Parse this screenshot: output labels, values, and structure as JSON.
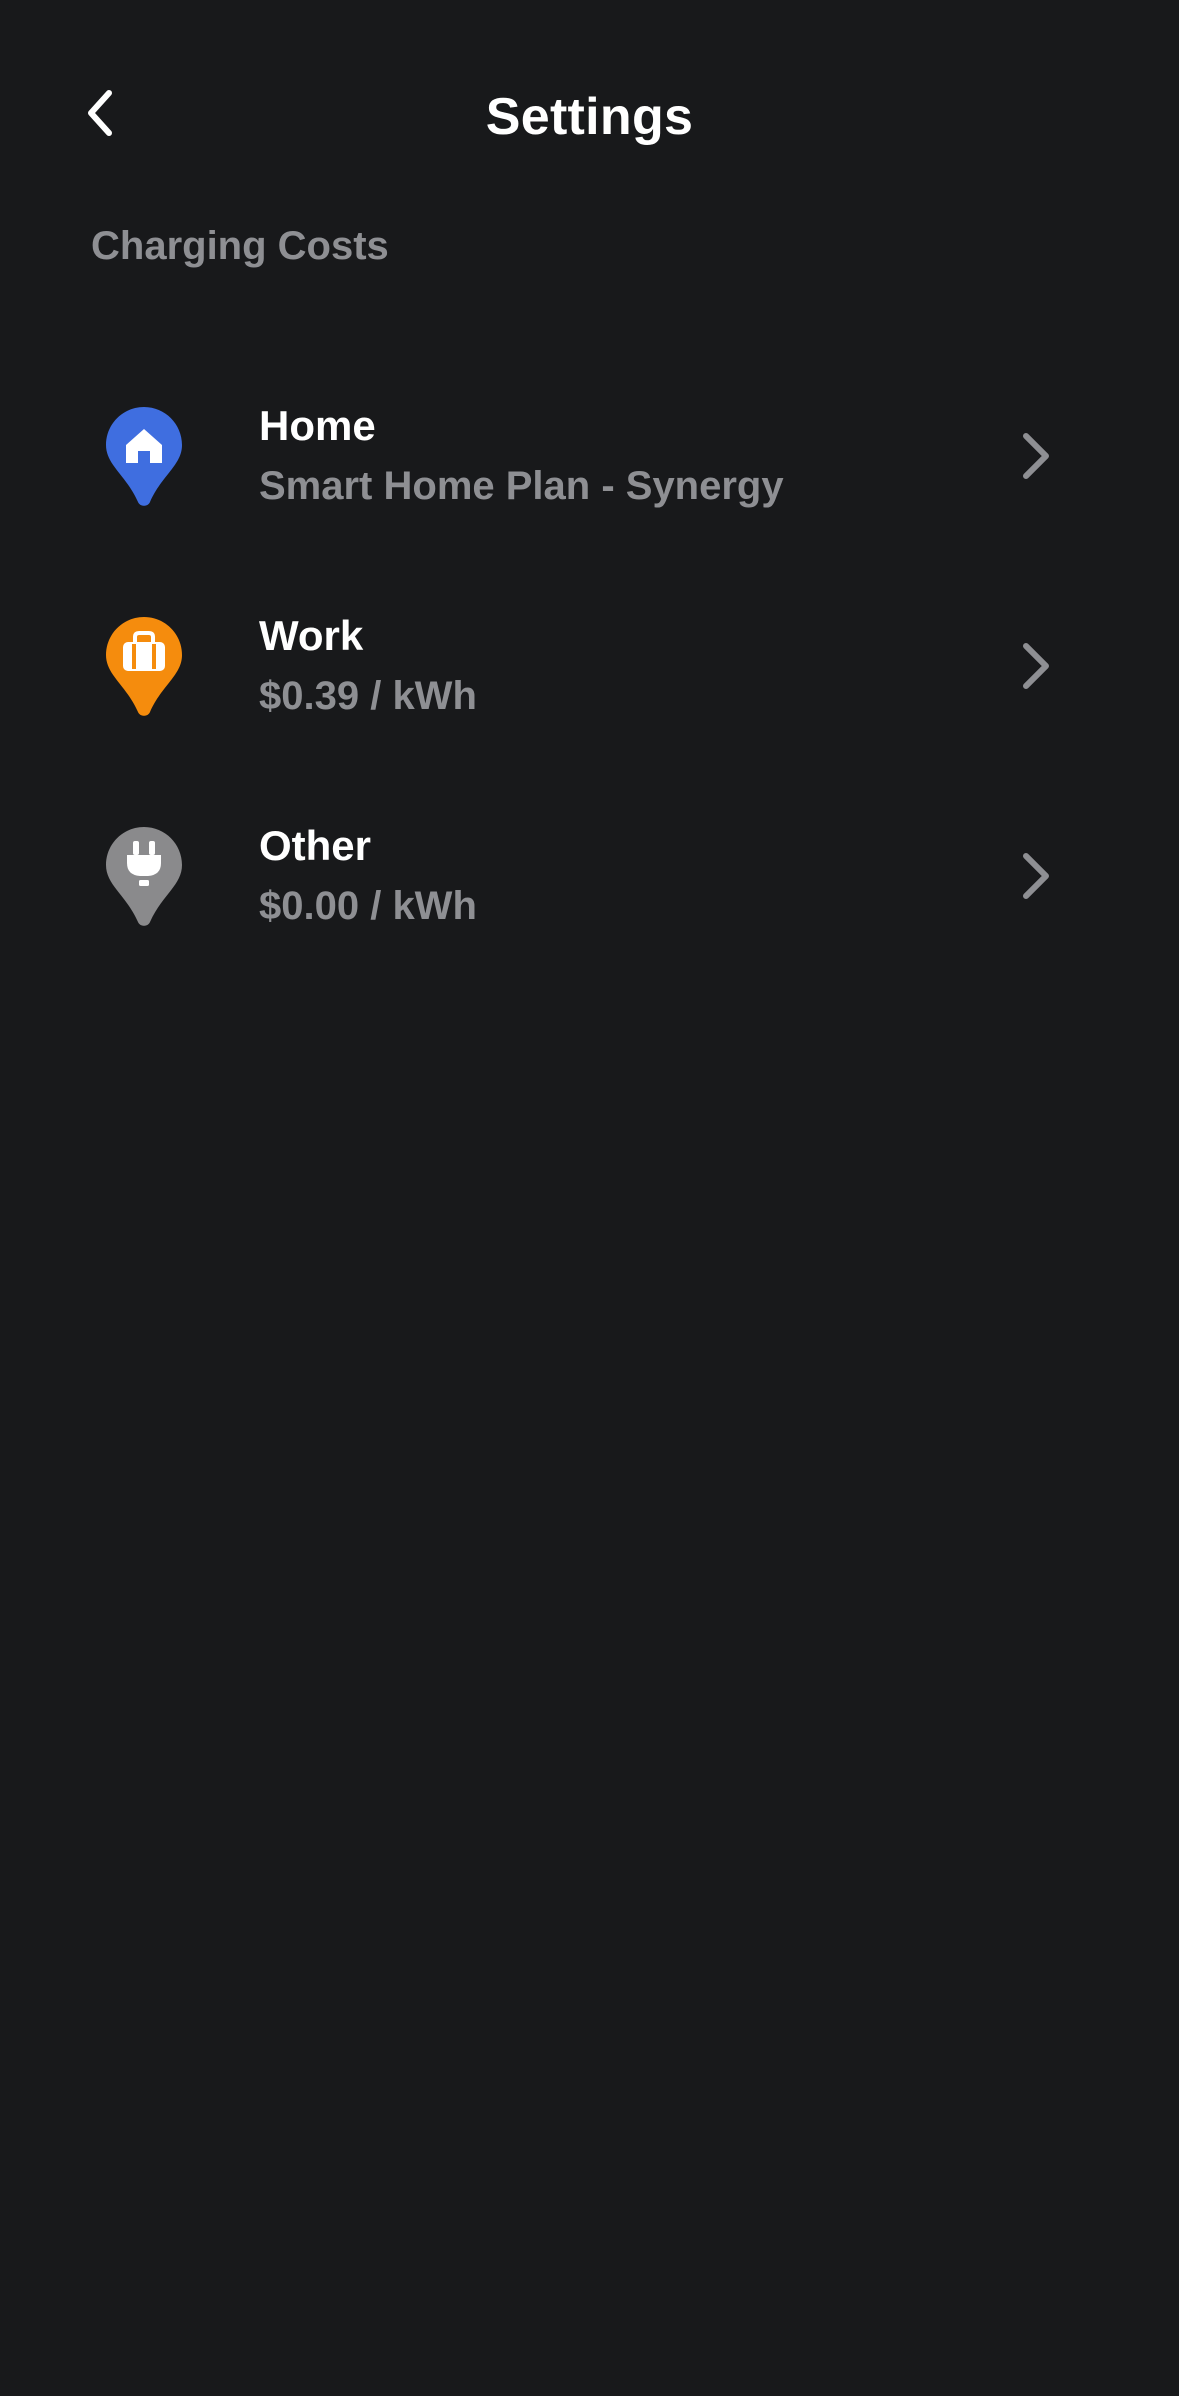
{
  "header": {
    "title": "Settings",
    "back_icon": "chevron-left-icon"
  },
  "section": {
    "title": "Charging Costs"
  },
  "locations": [
    {
      "name": "Home",
      "detail": "Smart Home Plan - Synergy",
      "icon": "home-pin-icon",
      "color": "#3f6ee0"
    },
    {
      "name": "Work",
      "detail": "$0.39 / kWh",
      "icon": "briefcase-pin-icon",
      "color": "#f58c0d"
    },
    {
      "name": "Other",
      "detail": "$0.00 / kWh",
      "icon": "plug-pin-icon",
      "color": "#8a8a8c"
    }
  ],
  "colors": {
    "background": "#18191b",
    "primary_text": "#ffffff",
    "secondary_text": "#8e8f93",
    "chevron": "#8e8f93"
  }
}
